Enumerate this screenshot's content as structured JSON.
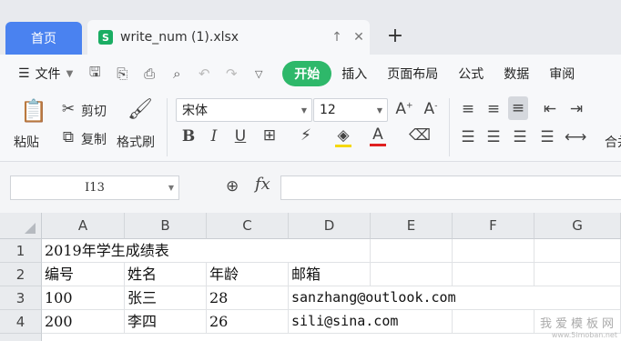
{
  "titlebar": {
    "home_tab": "首页",
    "doc_icon": "S",
    "doc_tab": "write_num (1).xlsx",
    "pin_icon": "pin-icon",
    "close_icon": "close-icon",
    "new_tab": "+"
  },
  "menubar": {
    "file_label": "文件",
    "tabs": [
      "开始",
      "插入",
      "页面布局",
      "公式",
      "数据",
      "审阅"
    ]
  },
  "ribbon": {
    "paste_label": "粘贴",
    "cut_label": "剪切",
    "copy_label": "复制",
    "format_painter_label": "格式刷",
    "font_name": "宋体",
    "font_size": "12",
    "bold": "B",
    "italic": "I",
    "underline": "U",
    "font_color": "A",
    "merge_label": "合并"
  },
  "formula_bar": {
    "name_box": "I13",
    "fx": "fx",
    "value": ""
  },
  "grid": {
    "columns": [
      "A",
      "B",
      "C",
      "D",
      "E",
      "F",
      "G"
    ],
    "rows": [
      "1",
      "2",
      "3",
      "4"
    ],
    "cells": {
      "r1": [
        "2019年学生成绩表",
        "",
        "",
        "",
        "",
        "",
        ""
      ],
      "r2": [
        "编号",
        "姓名",
        "年龄",
        "邮箱",
        "",
        "",
        ""
      ],
      "r3": [
        "100",
        "张三",
        "28",
        "sanzhang@outlook.com",
        "",
        "",
        ""
      ],
      "r4": [
        "200",
        "李四",
        "26",
        "sili@sina.com",
        "",
        "",
        ""
      ]
    }
  },
  "watermark": {
    "line1": "我爱模板网",
    "line2": "www.5imoban.net"
  },
  "colors": {
    "home_tab": "#4a82f0",
    "active_tab": "#2eb86a",
    "sheet_icon": "#1aad63"
  }
}
